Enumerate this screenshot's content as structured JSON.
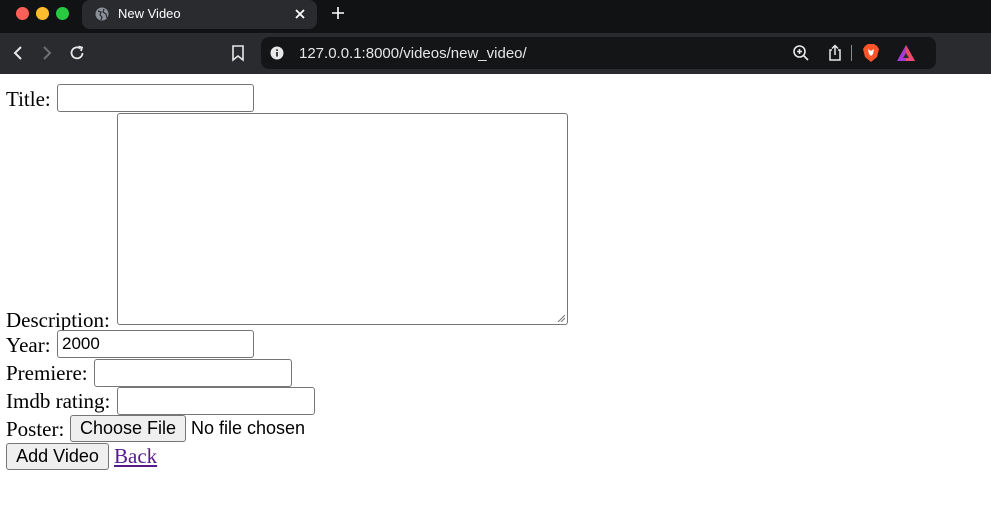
{
  "browser": {
    "tab_title": "New Video",
    "url": "127.0.0.1:8000/videos/new_video/"
  },
  "form": {
    "title_label": "Title:",
    "title_value": "",
    "description_label": "Description:",
    "year_label": "Year:",
    "year_value": "2000",
    "premiere_label": "Premiere:",
    "premiere_value": "",
    "imdb_label": "Imdb rating:",
    "imdb_value": "",
    "poster_label": "Poster:",
    "choose_file_label": "Choose File",
    "no_file_text": "No file chosen",
    "submit_label": "Add Video",
    "back_link": "Back"
  },
  "colors": {
    "tabbar_bg": "#111214",
    "toolbar_bg": "#2a2b2f",
    "link_visited": "#551a8b",
    "brave_orange": "#fb542b"
  },
  "icons": [
    "globe-icon",
    "close-icon",
    "plus-icon",
    "back-arrow-icon",
    "forward-arrow-icon",
    "reload-icon",
    "bookmark-icon",
    "info-icon",
    "zoom-icon",
    "share-icon",
    "brave-shield-icon",
    "brave-rewards-icon"
  ]
}
